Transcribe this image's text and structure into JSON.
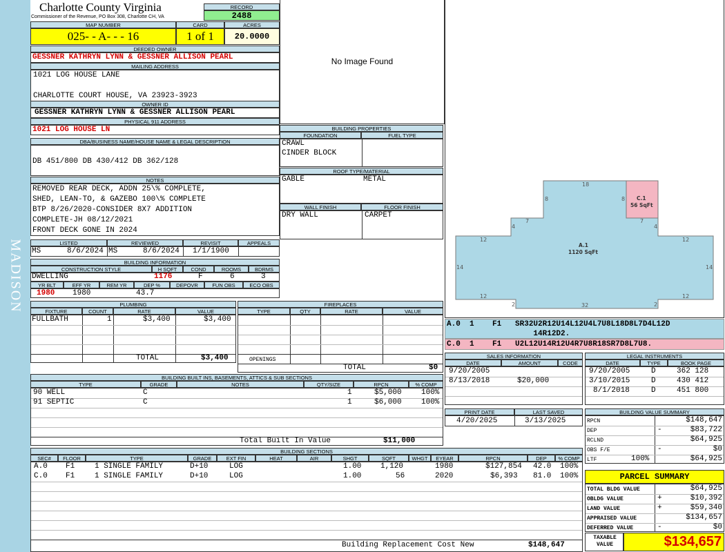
{
  "side_label": "MADISON",
  "county": {
    "name": "Charlotte County Virginia",
    "subtitle": "Commissioner of the Revenue, PO Box 308, Charlotte CH, VA"
  },
  "record": {
    "label": "RECORD",
    "value": "2488"
  },
  "map": {
    "label": "MAP NUMBER",
    "value": "025- - A- - - 16"
  },
  "card": {
    "label": "CARD",
    "value": "1 of 1"
  },
  "acres": {
    "label": "ACRES",
    "value": "20.0000"
  },
  "deeded_owner": {
    "label": "DEEDED OWNER",
    "value": "GESSNER KATHRYN LYNN & GESSNER ALLISON PEARL"
  },
  "mailing": {
    "label": "MAILING ADDRESS",
    "line1": "1021 LOG HOUSE LANE",
    "line2": "",
    "line3": "CHARLOTTE COURT HOUSE, VA 23923-3923"
  },
  "owner_id": {
    "label": "OWNER ID",
    "value": "GESSNER KATHRYN LYNN & GESSNER ALLISON PEARL"
  },
  "physical": {
    "label": "PHYSICAL 911 ADDRESS",
    "value": "1021 LOG HOUSE LN"
  },
  "legal_desc": {
    "label": "DBA/BUSINESS NAME/HOUSE NAME & LEGAL DESCRIPTION",
    "value": "DB 451/800 DB 430/412 DB 362/128"
  },
  "notes": {
    "label": "NOTES",
    "lines": [
      "REMOVED REAR DECK, ADDN 25\\% COMPLETE,",
      "SHED, LEAN-TO, & GAZEBO 100\\% COMPLETE",
      "BTP 8/26/2020-CONSIDER 8X7 ADDITION",
      "COMPLETE-JH 08/12/2021",
      "FRONT DECK GONE IN 2024"
    ]
  },
  "listed": {
    "labels": [
      "LISTED",
      "REVIEWED",
      "REVISIT",
      "APPEALS"
    ],
    "listed_by": "MS",
    "listed_date": "8/6/2024",
    "reviewed_by": "MS",
    "reviewed_date": "8/6/2024",
    "revisit": "1/1/1900",
    "appeals": ""
  },
  "building_info": {
    "label": "BUILDING INFORMATION",
    "headers": [
      "CONSTRUCTION STYLE",
      "H SQFT",
      "COND",
      "ROOMS",
      "BDRMS"
    ],
    "style": "DWELLING",
    "hsqft": "1176",
    "cond": "F",
    "rooms": "6",
    "bdrms": "3",
    "headers2": [
      "YR BLT",
      "EFF YR",
      "REM YR",
      "DEP %",
      "DEPOVR",
      "FUN OBS",
      "ECO OBS"
    ],
    "yr_blt": "1980",
    "eff_yr": "1980",
    "rem_yr": "",
    "dep": "43.7",
    "depovr": "",
    "fun_obs": "",
    "eco_obs": ""
  },
  "image": {
    "text": "No Image Found"
  },
  "building_props": {
    "label": "BUILDING PROPERTIES",
    "foundation_label": "FOUNDATION",
    "fuel_label": "FUEL TYPE",
    "foundation": [
      "CRAWL",
      "CINDER BLOCK"
    ],
    "fuel": "",
    "roof_label": "ROOF TYPE/MATERIAL",
    "roof_type": "GABLE",
    "roof_material": "METAL",
    "wall_label": "WALL FINISH",
    "floor_label": "FLOOR FINISH",
    "wall": "DRY WALL",
    "floor": "CARPET"
  },
  "sketch": {
    "a_label": "A.1",
    "a_area": "1120 SqFt",
    "c_label": "C.1",
    "c_area": "56 SqFt",
    "dims": [
      "18",
      "8",
      "8",
      "7",
      "7",
      "4",
      "4",
      "12",
      "12",
      "14",
      "14",
      "12",
      "12",
      "2",
      "2",
      "32"
    ]
  },
  "vectors": [
    {
      "line1": "A.0  1    F1   SR32U2R12U14L12U4L7U8L18D8L7D4L12D",
      "line2": "                   14R12D2."
    },
    {
      "line1": "C.0  1    F1   U2L12U14R12U4R7U8R18SR7D8L7U8."
    }
  ],
  "plumbing": {
    "label": "PLUMBING",
    "headers": [
      "FIXTURE",
      "COUNT",
      "RATE",
      "VALUE"
    ],
    "rows": [
      {
        "fixture": "FULLBATH",
        "count": "1",
        "rate": "$3,400",
        "value": "$3,400"
      }
    ],
    "total_label": "TOTAL",
    "total": "$3,400"
  },
  "fireplaces": {
    "label": "FIREPLACES",
    "headers": [
      "TYPE",
      "QTY",
      "RATE",
      "VALUE"
    ],
    "openings_label": "OPENINGS",
    "total_label": "TOTAL",
    "total": "$0"
  },
  "sales": {
    "label": "SALES INFORMATION",
    "headers": [
      "DATE",
      "AMOUNT",
      "CODE"
    ],
    "rows": [
      {
        "date": "9/20/2005",
        "amount": "",
        "code": ""
      },
      {
        "date": "8/13/2018",
        "amount": "$20,000",
        "code": ""
      }
    ]
  },
  "legal": {
    "label": "LEGAL INSTRUMENTS",
    "headers": [
      "DATE",
      "TYPE",
      "BOOK PAGE"
    ],
    "rows": [
      {
        "date": "9/20/2005",
        "type": "D",
        "book": "362 128"
      },
      {
        "date": "3/10/2015",
        "type": "D",
        "book": "430 412"
      },
      {
        "date": "8/1/2018",
        "type": "D",
        "book": "451 800"
      }
    ]
  },
  "print": {
    "labels": [
      "PRINT DATE",
      "LAST SAVED"
    ],
    "print_date": "4/20/2025",
    "last_saved": "3/13/2025"
  },
  "bvs": {
    "label": "BUILDING VALUE SUMMARY",
    "rows": [
      {
        "k": "RPCN",
        "s": "",
        "v": "$148,647"
      },
      {
        "k": "DEP",
        "s": "-",
        "v": "$83,722"
      },
      {
        "k": "RCLND",
        "s": "",
        "v": "$64,925"
      },
      {
        "k": "OBS F/E",
        "s": "-",
        "v": "$0"
      },
      {
        "k": "LTF",
        "p": "100%",
        "s": "",
        "v": "$64,925"
      }
    ]
  },
  "parcel": {
    "label": "PARCEL SUMMARY",
    "rows": [
      {
        "k": "TOTAL BLDG VALUE",
        "s": "",
        "v": "$64,925"
      },
      {
        "k": "OBLDG VALUE",
        "s": "+",
        "v": "$10,392"
      },
      {
        "k": "LAND VALUE",
        "s": "+",
        "v": "$59,340"
      },
      {
        "k": "APPRAISED VALUE",
        "s": "",
        "v": "$134,657"
      },
      {
        "k": "DEFERRED VALUE",
        "s": "-",
        "v": "$0"
      }
    ],
    "taxable_label": "TAXABLE VALUE",
    "taxable": "$134,657"
  },
  "builtins": {
    "label": "BUILDING BUILT INS, BASEMENTS, ATTICS & SUB SECTIONS",
    "headers": [
      "TYPE",
      "GRADE",
      "NOTES",
      "QTY/SIZE",
      "RPCN",
      "% COMP"
    ],
    "rows": [
      {
        "type": "90 WELL",
        "grade": "C",
        "notes": "",
        "qty": "1",
        "rpcn": "$5,000",
        "comp": "100%"
      },
      {
        "type": "91 SEPTIC",
        "grade": "C",
        "notes": "",
        "qty": "1",
        "rpcn": "$6,000",
        "comp": "100%"
      }
    ],
    "total_label": "Total Built In Value",
    "total": "$11,000"
  },
  "sections": {
    "label": "BUILDING SECTIONS",
    "headers": [
      "SEC#",
      "FLOOR",
      "TYPE",
      "GRADE",
      "EXT FIN",
      "HEAT",
      "AIR",
      "SHGT",
      "SQFT",
      "WHGT",
      "EYEAR",
      "RPCN",
      "DEP",
      "% COMP"
    ],
    "rows": [
      {
        "sec": "A.0",
        "floor": "F1",
        "type": "1 SINGLE FAMILY",
        "grade": "D+10",
        "ext": "LOG",
        "heat": "",
        "air": "",
        "shgt": "1.00",
        "sqft": "1,120",
        "whgt": "",
        "eyear": "1980",
        "rpcn": "$127,854",
        "dep": "42.0",
        "comp": "100%"
      },
      {
        "sec": "C.0",
        "floor": "F1",
        "type": "1 SINGLE FAMILY",
        "grade": "D+10",
        "ext": "LOG",
        "heat": "",
        "air": "",
        "shgt": "1.00",
        "sqft": "56",
        "whgt": "",
        "eyear": "2020",
        "rpcn": "$6,393",
        "dep": "81.0",
        "comp": "100%"
      }
    ],
    "total_label": "Building Replacement Cost New",
    "total": "$148,647"
  },
  "colors": {
    "header_bg": "#c5dfea",
    "side_bg": "#a9d4e4",
    "highlight": "#ffff00",
    "record_bg": "#90ee90",
    "red_text": "#d40000",
    "sketch_fill": "#add8e6",
    "sketch_c_fill": "#f4b6c2"
  }
}
